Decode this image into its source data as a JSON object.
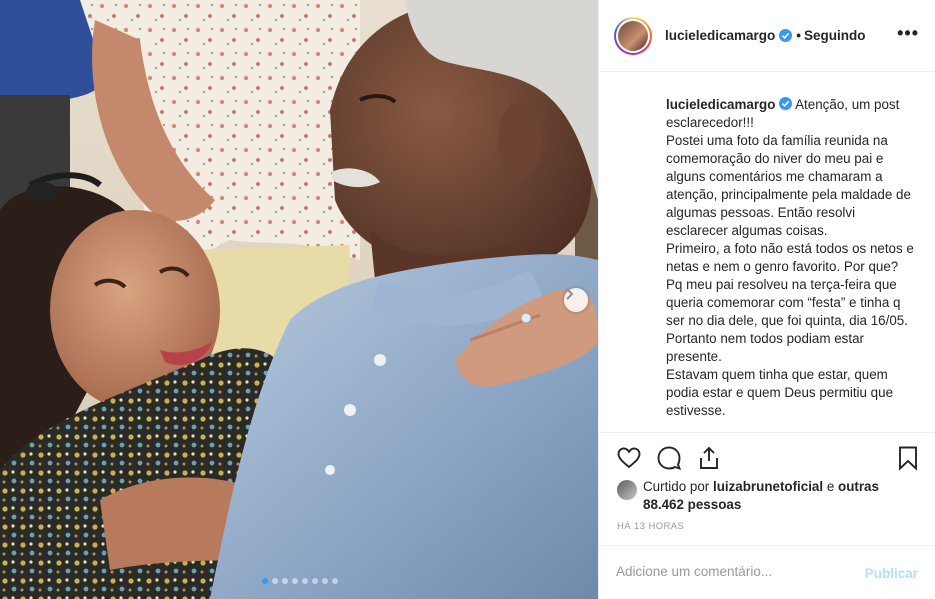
{
  "post": {
    "username": "lucieledicamargo",
    "follow_separator": "•",
    "follow_status": "Seguindo",
    "more_icon": "•••",
    "caption_paragraphs": [
      "Atenção, um post esclarecedor!!!",
      "Postei uma foto da família reunida na comemoração do niver do meu pai e alguns comentários me chamaram a atenção, principalmente pela maldade de algumas pessoas. Então resolvi esclarecer algumas coisas.",
      "Primeiro, a foto não está todos os netos e netas e nem o genro favorito. Por que?",
      "Pq meu pai resolveu na terça-feira que queria comemorar com “festa” e tinha q ser no dia dele, que foi quinta, dia 16/05. Portanto nem todos podiam estar presente.",
      "Estavam quem tinha que estar, quem podia estar e quem Deus permitiu que estivesse."
    ],
    "likes": {
      "prefix": "Curtido por",
      "user": "luizabrunetoficial",
      "and": "e",
      "others": "outras 88.462 pessoas"
    },
    "time": "HÁ 13 HORAS",
    "comment_placeholder": "Adicione um comentário...",
    "publish_label": "Publicar"
  },
  "carousel": {
    "count": 8,
    "active_index": 0
  },
  "colors": {
    "accent": "#3897f0",
    "publish_disabled": "#b2dffc",
    "verified": "#3897f0",
    "divider": "#efefef"
  },
  "icons": [
    "heart-icon",
    "comment-icon",
    "share-icon",
    "bookmark-icon",
    "verified-badge-icon",
    "chevron-right-icon",
    "more-options-icon"
  ]
}
